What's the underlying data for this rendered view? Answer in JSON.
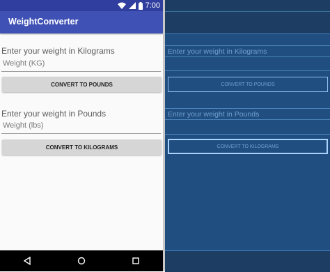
{
  "status_bar": {
    "time": "7:00"
  },
  "app_bar": {
    "title": "WeightConverter"
  },
  "kg_section": {
    "label": "Enter your weight in Kilograms",
    "input_placeholder": "Weight (KG)",
    "button_label": "CONVERT TO POUNDS"
  },
  "lbs_section": {
    "label": "Enter your weight in Pounds",
    "input_placeholder": "Weight (lbs)",
    "button_label": "CONVERT TO KILOGRAMS"
  },
  "blueprint": {
    "kg_label": "Enter your weight in Kilograms",
    "kg_button": "CONVERT TO POUNDS",
    "lbs_label": "Enter your weight in Pounds",
    "lbs_button": "CONVERT TO KILOGRAMS"
  },
  "icons": [
    "wifi-icon",
    "signal-icon",
    "battery-icon",
    "back-icon",
    "home-icon",
    "recents-icon"
  ],
  "colors": {
    "primary": "#3f51b5",
    "primary_dark": "#303f9f",
    "blueprint_bg": "#204e80"
  }
}
